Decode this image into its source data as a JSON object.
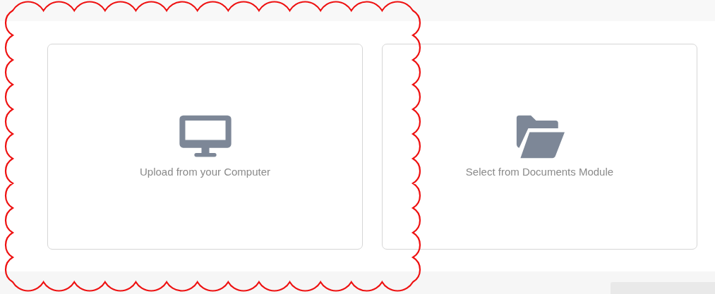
{
  "options": [
    {
      "kind": "computer",
      "label": "Upload from your Computer"
    },
    {
      "kind": "folder",
      "label": "Select from Documents Module"
    }
  ]
}
